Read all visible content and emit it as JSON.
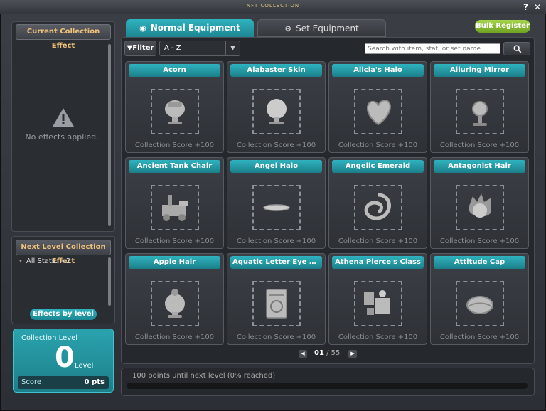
{
  "window": {
    "title": "NFT COLLECTION"
  },
  "sidebar": {
    "current_effect_header": "Current Collection Effect",
    "no_effects": "No effects applied.",
    "next_level_header": "Next Level Collection Effect",
    "next_level_stats": [
      "All Stats: +2"
    ],
    "effects_by_level_label": "Effects by level",
    "collection_level_label": "Collection Level",
    "level_value": "0",
    "level_suffix": "Level",
    "score_label": "Score",
    "score_value": "0 pts"
  },
  "tabs": [
    {
      "label": "Normal Equipment",
      "active": true
    },
    {
      "label": "Set Equipment",
      "active": false
    }
  ],
  "toolbar": {
    "bulk_register_label": "Bulk Register",
    "filter_label": "Filter",
    "sort_value": "A - Z",
    "search_placeholder": "Search with item, stat, or set name"
  },
  "items": [
    {
      "name": "Acorn",
      "score": "Collection Score +100",
      "icon": "acorn-icon"
    },
    {
      "name": "Alabaster Skin",
      "score": "Collection Score +100",
      "icon": "head-icon"
    },
    {
      "name": "Alicia's Halo",
      "score": "Collection Score +100",
      "icon": "heart-halo-icon"
    },
    {
      "name": "Alluring Mirror",
      "score": "Collection Score +100",
      "icon": "mirror-icon"
    },
    {
      "name": "Ancient Tank Chair",
      "score": "Collection Score +100",
      "icon": "tank-chair-icon"
    },
    {
      "name": "Angel Halo",
      "score": "Collection Score +100",
      "icon": "halo-icon"
    },
    {
      "name": "Angelic Emerald",
      "score": "Collection Score +100",
      "icon": "emerald-icon"
    },
    {
      "name": "Antagonist Hair",
      "score": "Collection Score +100",
      "icon": "hair-icon"
    },
    {
      "name": "Apple Hair",
      "score": "Collection Score +100",
      "icon": "apple-hair-icon"
    },
    {
      "name": "Aquatic Letter Eye Acc...",
      "score": "Collection Score +100",
      "icon": "letter-eye-icon"
    },
    {
      "name": "Athena Pierce's Class",
      "score": "Collection Score +100",
      "icon": "classroom-icon"
    },
    {
      "name": "Attitude Cap",
      "score": "Collection Score +100",
      "icon": "cap-icon"
    }
  ],
  "pagination": {
    "current": "01",
    "separator": "/",
    "total": "55"
  },
  "progress": {
    "text": "100 points until next level (0% reached)",
    "percent": 0
  },
  "colors": {
    "accent": "#2fb3bf",
    "bulk": "#8fc23a",
    "header_text": "#f0c27a"
  }
}
